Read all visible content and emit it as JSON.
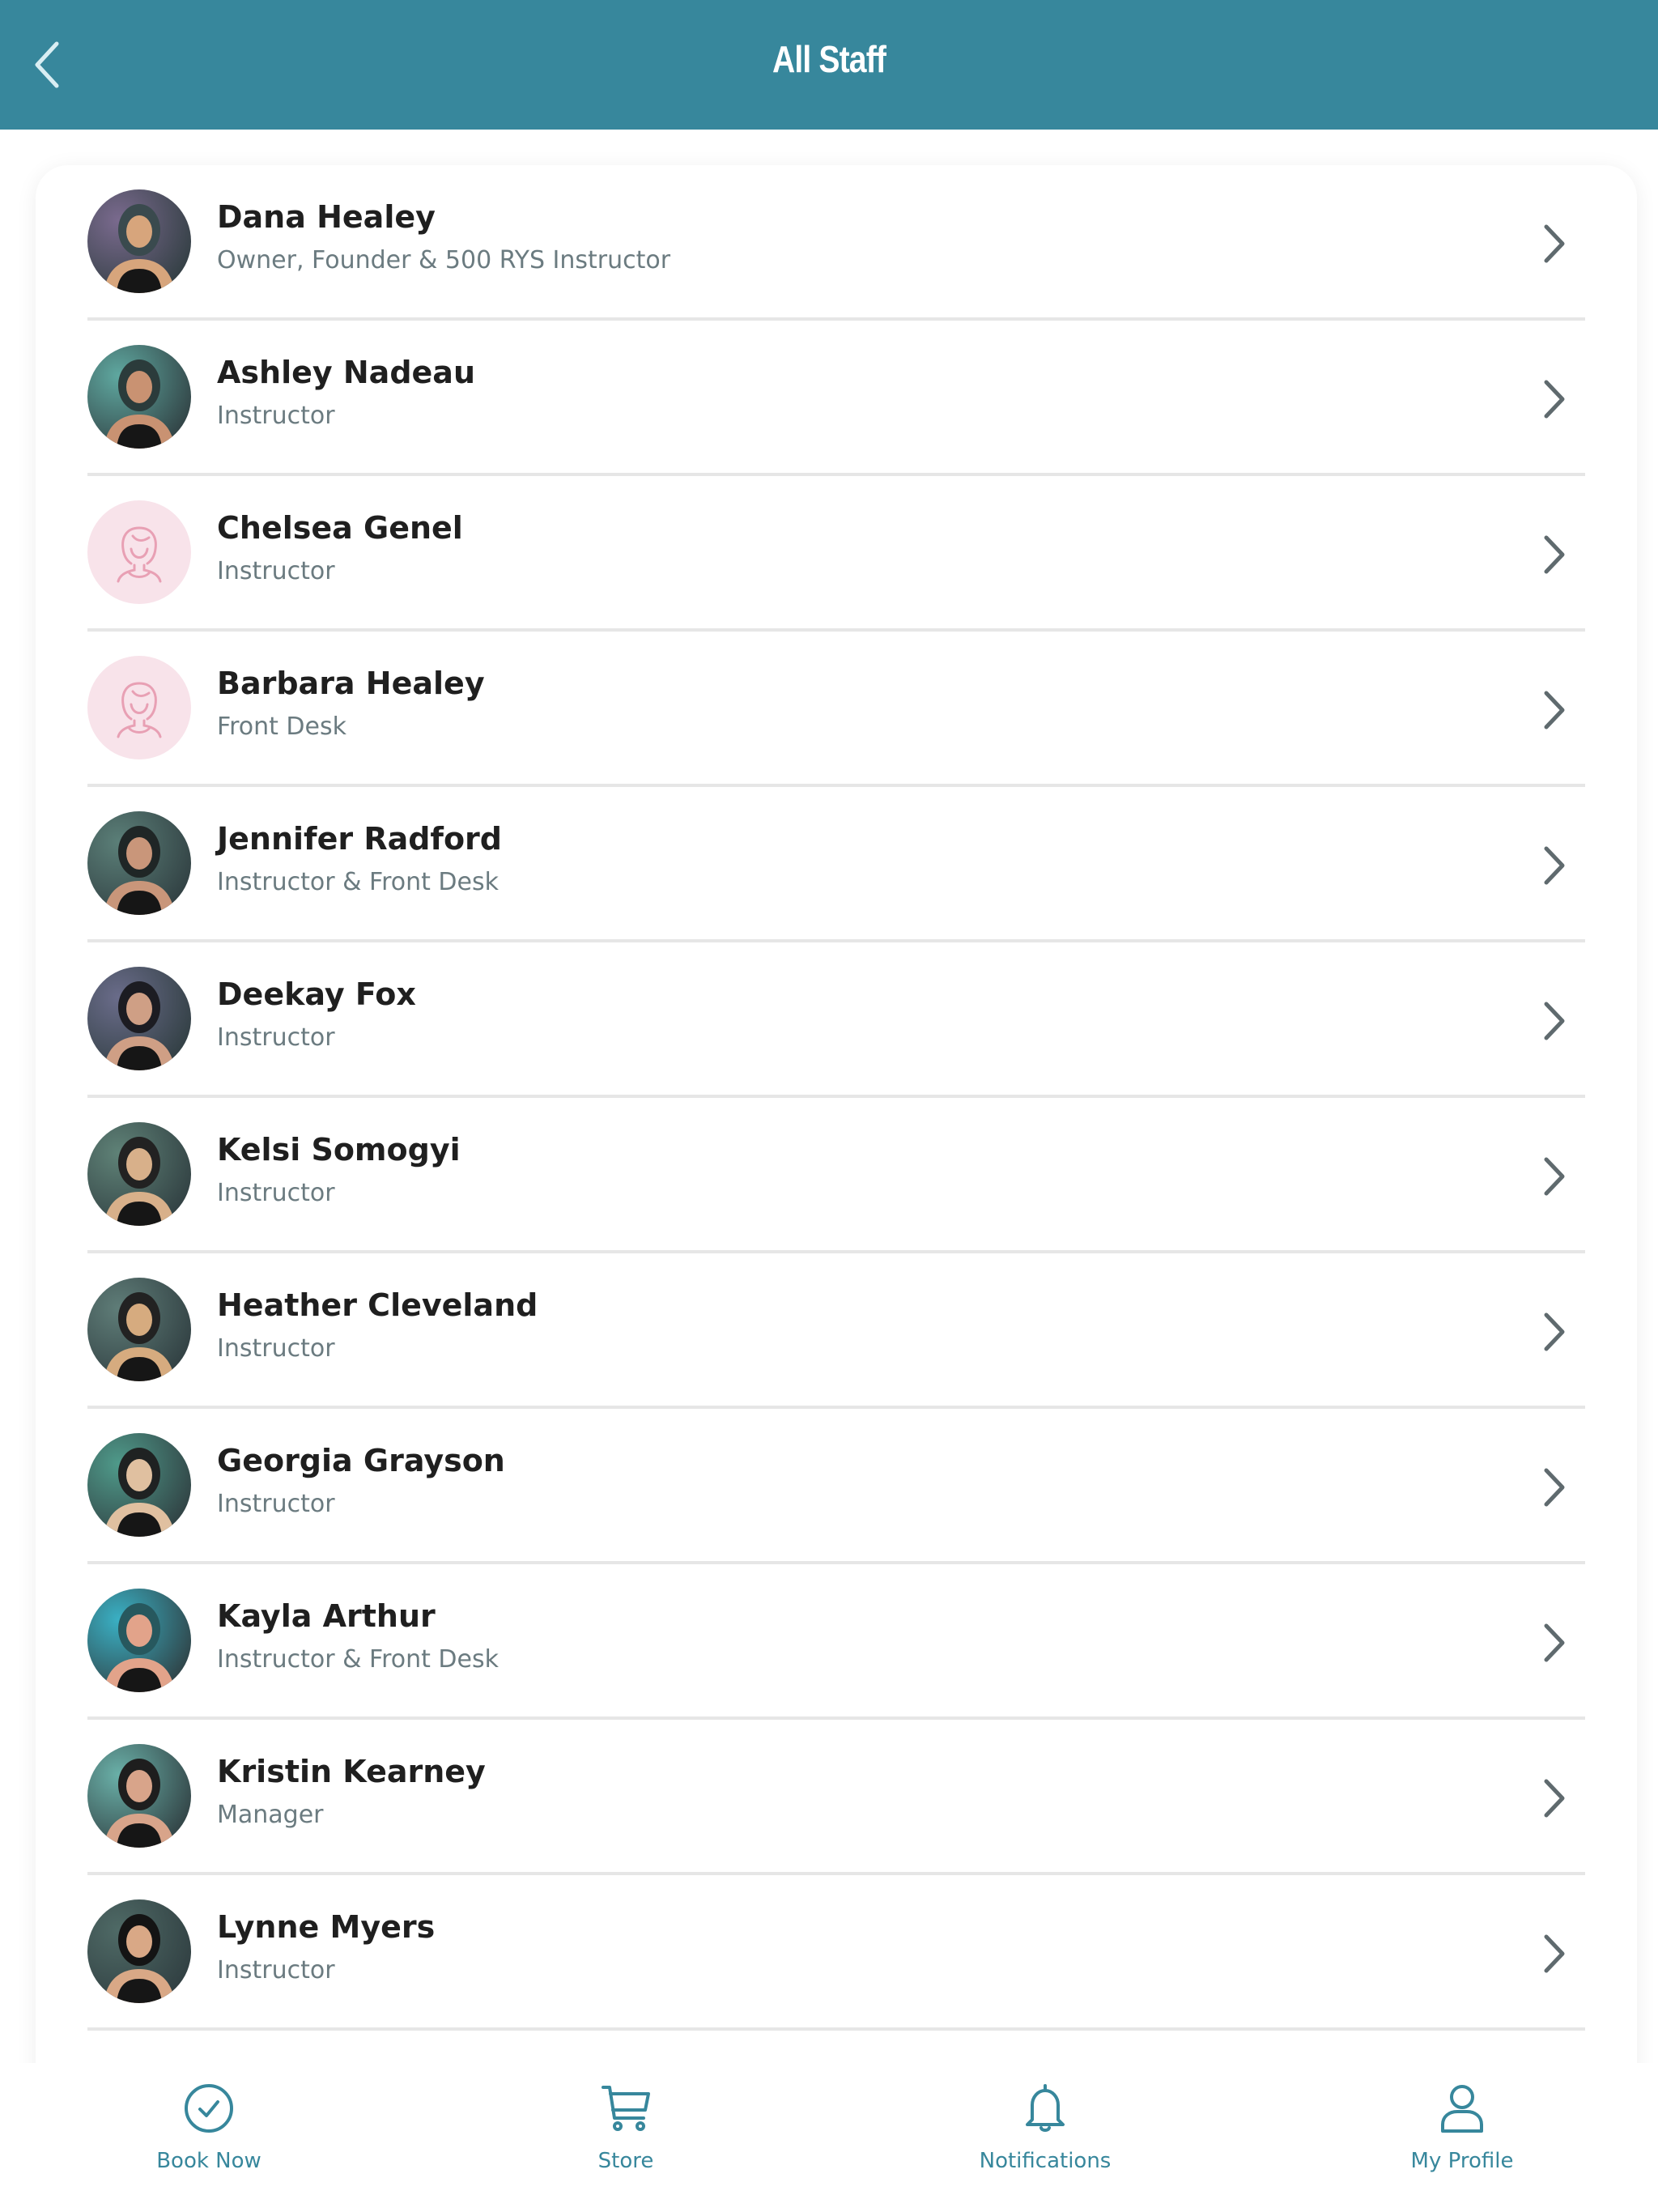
{
  "header": {
    "title": "All Staff",
    "back_icon": "chevron-left-icon"
  },
  "colors": {
    "brand": "#37879c",
    "placeholder_avatar_bg": "#f8e3ea",
    "placeholder_avatar_stroke": "#e8a0b4",
    "name_text": "#1f1f1f",
    "role_text": "#6b7b80"
  },
  "staff": [
    {
      "name": "Dana Healey",
      "role": "Owner, Founder & 500 RYS Instructor",
      "avatar": "photo",
      "tone": [
        "#7a6a8e",
        "#3a4a4e",
        "#d7a57c"
      ]
    },
    {
      "name": "Ashley Nadeau",
      "role": "Instructor",
      "avatar": "photo",
      "tone": [
        "#5fa8a0",
        "#2b3b3b",
        "#c99272"
      ]
    },
    {
      "name": "Chelsea Genel",
      "role": "Instructor",
      "avatar": "placeholder"
    },
    {
      "name": "Barbara Healey",
      "role": "Front Desk",
      "avatar": "placeholder"
    },
    {
      "name": "Jennifer Radford",
      "role": "Instructor & Front Desk",
      "avatar": "photo",
      "tone": [
        "#5b7f78",
        "#1f2626",
        "#c9967a"
      ]
    },
    {
      "name": "Deekay Fox",
      "role": "Instructor",
      "avatar": "photo",
      "tone": [
        "#6a6c8a",
        "#1c1c22",
        "#cf9f85"
      ]
    },
    {
      "name": "Kelsi Somogyi",
      "role": "Instructor",
      "avatar": "photo",
      "tone": [
        "#5f8277",
        "#222",
        "#d8b08a"
      ]
    },
    {
      "name": "Heather Cleveland",
      "role": "Instructor",
      "avatar": "photo",
      "tone": [
        "#5f7d78",
        "#222",
        "#d6ab7f"
      ]
    },
    {
      "name": "Georgia Grayson",
      "role": "Instructor",
      "avatar": "photo",
      "tone": [
        "#4f9a8a",
        "#1f2222",
        "#e0c0a0"
      ]
    },
    {
      "name": "Kayla Arthur",
      "role": "Instructor & Front Desk",
      "avatar": "photo",
      "tone": [
        "#3ab0c4",
        "#27585e",
        "#e2a38a"
      ]
    },
    {
      "name": "Kristin Kearney",
      "role": "Manager",
      "avatar": "photo",
      "tone": [
        "#6ab0a8",
        "#1e1e1e",
        "#d8a48a"
      ]
    },
    {
      "name": "Lynne Myers",
      "role": "Instructor",
      "avatar": "photo",
      "tone": [
        "#4f6a66",
        "#141414",
        "#d9a886"
      ]
    }
  ],
  "tabbar": {
    "tabs": [
      {
        "label": "Book Now",
        "icon": "check-circle-icon"
      },
      {
        "label": "Store",
        "icon": "cart-icon"
      },
      {
        "label": "Notifications",
        "icon": "bell-icon"
      },
      {
        "label": "My Profile",
        "icon": "user-icon"
      }
    ]
  }
}
